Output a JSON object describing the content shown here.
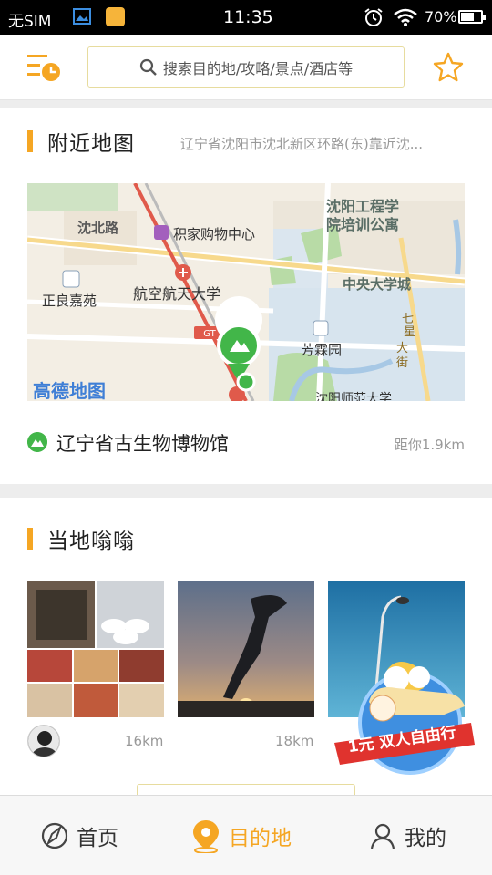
{
  "status_bar": {
    "carrier": "无SIM",
    "time": "11:35",
    "battery": "70%"
  },
  "header": {
    "search_placeholder": "搜索目的地/攻略/景点/酒店等"
  },
  "nearby_map": {
    "title": "附近地图",
    "address": "辽宁省沈阳市沈北新区环路(东)靠近沈...",
    "map_labels": {
      "shenbei_road": "沈北路",
      "jijia_mall": "积家购物中心",
      "shenyang_institute": "沈阳工程学",
      "training_apartment": "院培训公寓",
      "zhengliang_jiayuan": "正良嘉苑",
      "aerospace_university": "航空航天大学",
      "central_university_city": "中央大学城",
      "qixing_street_1": "七",
      "qixing_street_2": "星",
      "qixing_street_3": "大",
      "qixing_street_4": "街",
      "fanglin_yuan": "芳霖园",
      "shenyang_normal_university": "沈阳师范大学",
      "amap_logo": "高德地图",
      "metro_badge": "GT"
    },
    "place_name": "辽宁省古生物博物馆",
    "place_distance": "距你1.9km"
  },
  "local": {
    "title": "当地嗡嗡",
    "items": [
      {
        "distance": "16km"
      },
      {
        "distance": "18km"
      }
    ]
  },
  "promo": {
    "text": "1元 双人自由行"
  },
  "tabs": [
    {
      "label": "首页"
    },
    {
      "label": "目的地"
    },
    {
      "label": "我的"
    }
  ],
  "colors": {
    "accent": "#f5a623",
    "map_pin": "#42b649",
    "status_bar": "#000000"
  }
}
